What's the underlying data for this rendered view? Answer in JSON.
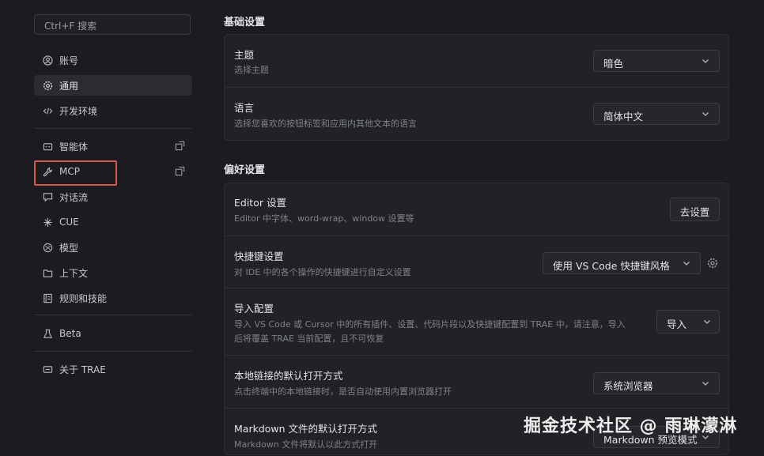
{
  "sidebar": {
    "search_placeholder": "Ctrl+F 搜索",
    "items": [
      {
        "label": "账号",
        "icon": "user-circle-icon"
      },
      {
        "label": "通用",
        "icon": "gear-icon"
      },
      {
        "label": "开发环境",
        "icon": "code-icon"
      },
      {
        "label": "智能体",
        "icon": "bot-icon"
      },
      {
        "label": "MCP",
        "icon": "wrench-icon"
      },
      {
        "label": "对话流",
        "icon": "chat-icon"
      },
      {
        "label": "CUE",
        "icon": "sparkle-icon"
      },
      {
        "label": "模型",
        "icon": "model-icon"
      },
      {
        "label": "上下文",
        "icon": "context-icon"
      },
      {
        "label": "规则和技能",
        "icon": "rules-icon"
      },
      {
        "label": "Beta",
        "icon": "flask-icon"
      },
      {
        "label": "关于 TRAE",
        "icon": "info-icon"
      }
    ],
    "active_item": "通用",
    "highlighted_item": "MCP"
  },
  "basic": {
    "title": "基础设置",
    "theme": {
      "label": "主题",
      "desc": "选择主题",
      "value": "暗色"
    },
    "language": {
      "label": "语言",
      "desc": "选择您喜欢的按钮标签和应用内其他文本的语言",
      "value": "简体中文"
    }
  },
  "prefs": {
    "title": "偏好设置",
    "editor": {
      "label": "Editor 设置",
      "desc": "Editor 中字体、word-wrap、window 设置等",
      "button": "去设置"
    },
    "shortcuts": {
      "label": "快捷键设置",
      "desc": "对 IDE 中的各个操作的快捷键进行自定义设置",
      "value": "使用 VS Code 快捷键风格"
    },
    "import": {
      "label": "导入配置",
      "desc1": "导入 VS Code 或 Cursor 中的所有插件、设置、代码片段以及快捷键配置到 TRAE 中，请注意，导入",
      "desc2": "后将覆盖 TRAE 当前配置，且不可恢复",
      "button": "导入"
    },
    "local_link": {
      "label": "本地链接的默认打开方式",
      "desc": "点击终端中的本地链接时，是否自动使用内置浏览器打开",
      "value": "系统浏览器"
    },
    "markdown": {
      "label": "Markdown 文件的默认打开方式",
      "desc": "Markdown 文件将默认以此方式打开",
      "value": "Markdown 预览模式"
    }
  },
  "watermark": "掘金技术社区 @ 雨琳濛淋",
  "colors": {
    "background": "#1b1c1f",
    "panel": "#212226",
    "highlight_box": "#d9534f"
  }
}
